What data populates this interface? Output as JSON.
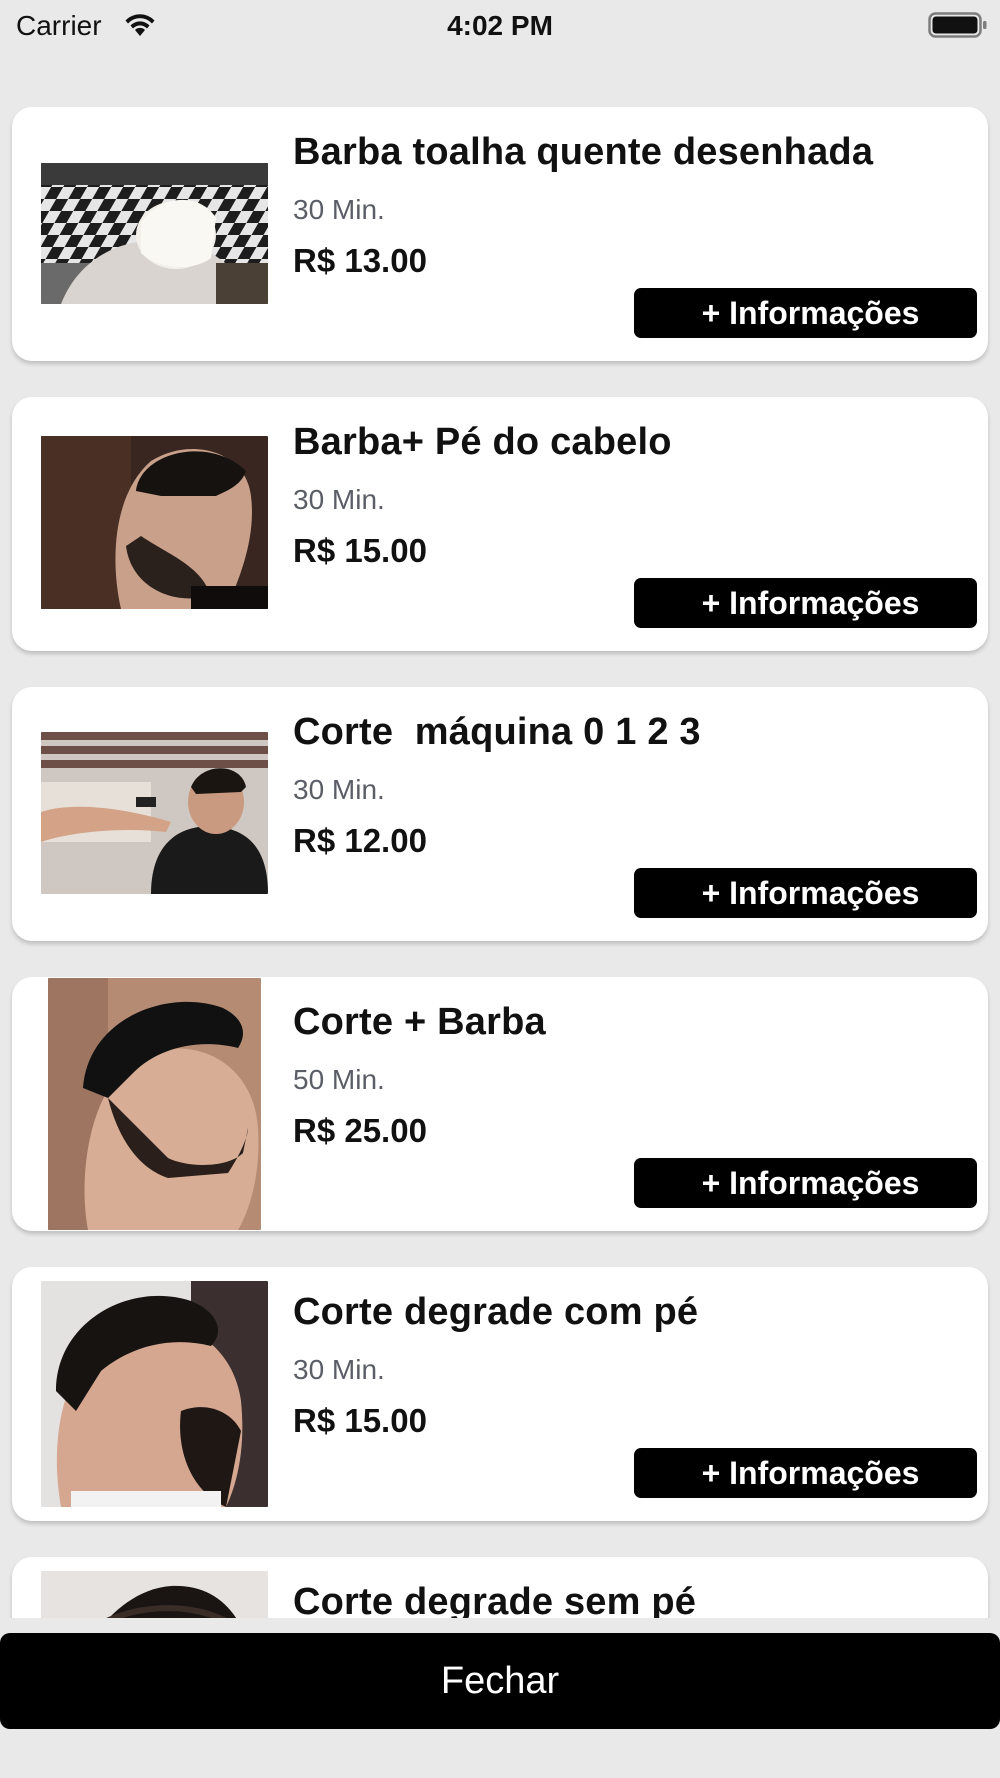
{
  "status_bar": {
    "carrier": "Carrier",
    "time": "4:02 PM",
    "wifi_icon": "wifi-icon",
    "battery_icon": "battery-full-icon"
  },
  "services": [
    {
      "title": "Barba toalha quente desenhada",
      "duration": "30 Min.",
      "price": "R$ 13.00",
      "button_label": "+ Informações",
      "image": "hot-towel-shave-photo"
    },
    {
      "title": "Barba+ Pé do cabelo",
      "duration": "30 Min.",
      "price": "R$ 15.00",
      "button_label": "+ Informações",
      "image": "beard-profile-photo"
    },
    {
      "title": "Corte  máquina 0 1 2 3",
      "duration": "30 Min.",
      "price": "R$ 12.00",
      "button_label": "+ Informações",
      "image": "clipper-cut-photo"
    },
    {
      "title": "Corte + Barba",
      "duration": "50 Min.",
      "price": "R$ 25.00",
      "button_label": "+ Informações",
      "image": "cut-and-beard-photo"
    },
    {
      "title": "Corte degrade com pé",
      "duration": "30 Min.",
      "price": "R$ 15.00",
      "button_label": "+ Informações",
      "image": "fade-cut-photo"
    },
    {
      "title": "Corte degrade sem pé",
      "duration": "",
      "price": "",
      "button_label": "",
      "image": "fade-cut-no-neckline-photo"
    }
  ],
  "footer": {
    "close_label": "Fechar"
  },
  "colors": {
    "background": "#e9e9ea",
    "card": "#ffffff",
    "button": "#000000",
    "button_text": "#ffffff",
    "duration_text": "#5b5e66"
  }
}
